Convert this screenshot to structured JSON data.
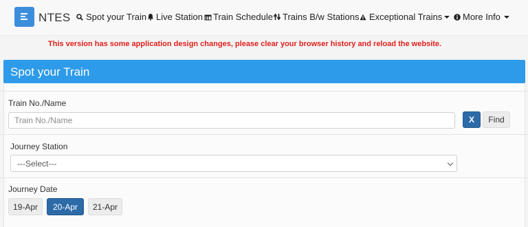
{
  "header": {
    "app_title": "NTES",
    "nav": [
      {
        "label": "Spot your Train",
        "icon": "search-icon"
      },
      {
        "label": "Live Station",
        "icon": "bell-icon"
      },
      {
        "label": "Train Schedule",
        "icon": "calendar-icon"
      },
      {
        "label": "Trains B/w Stations",
        "icon": "arrows-updown-icon"
      },
      {
        "label": "Exceptional Trains",
        "icon": "warning-icon"
      },
      {
        "label": "More Info",
        "icon": "info-icon"
      }
    ]
  },
  "notice": "This version has some application design changes, please clear your browser history and reload the website.",
  "panel": {
    "title": "Spot your Train",
    "train_label": "Train No./Name",
    "train_placeholder": "Train No./Name",
    "clear_button": "X",
    "find_button": "Find",
    "station_label": "Journey Station",
    "station_selected": "---Select---",
    "date_label": "Journey Date",
    "dates": [
      "19-Apr",
      "20-Apr",
      "21-Apr"
    ],
    "active_date": "20-Apr"
  },
  "colors": {
    "panel_header": "#2e9bea",
    "primary_button": "#2c6aa8",
    "notice_red": "#e0201d"
  }
}
